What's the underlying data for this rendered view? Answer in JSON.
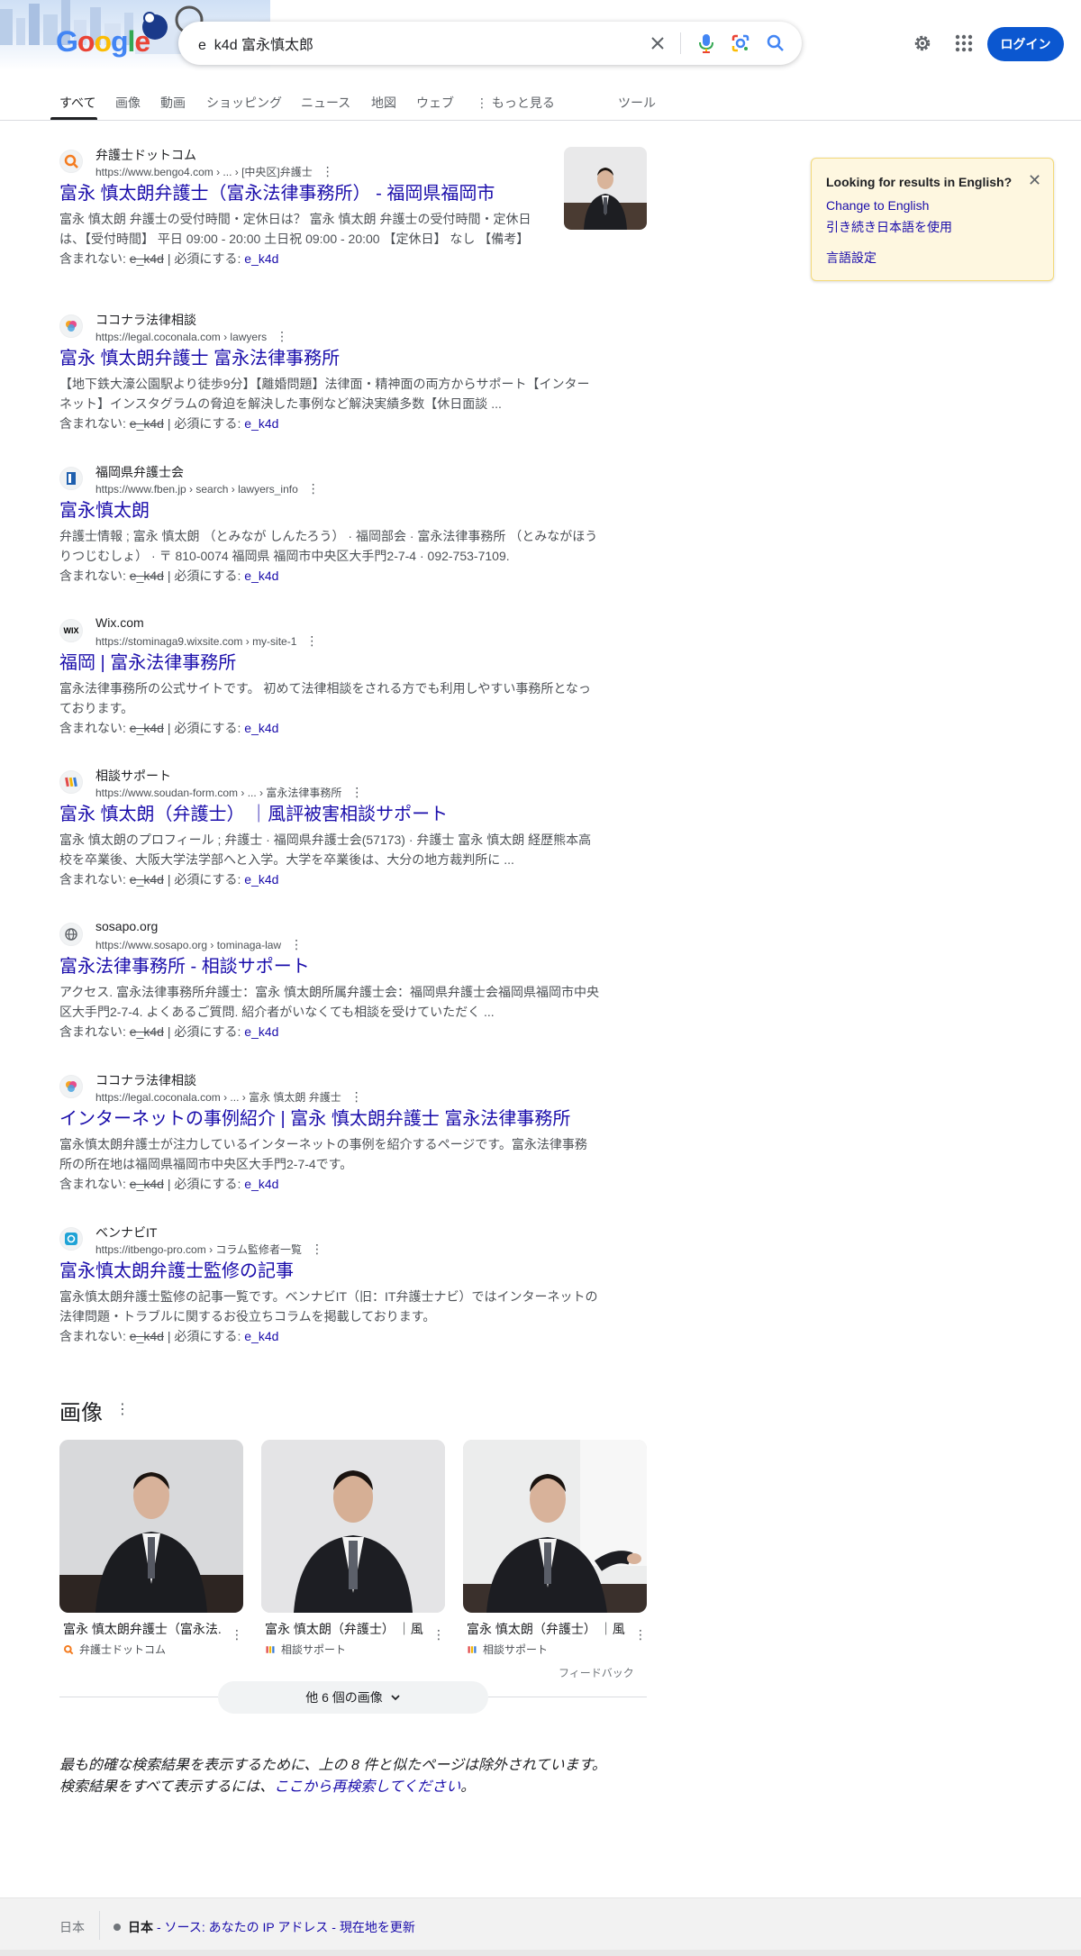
{
  "search": {
    "query": "e_k4d 富永慎太郎",
    "logo_text": "Google"
  },
  "header": {
    "login_label": "ログイン"
  },
  "tabs": [
    "すべて",
    "画像",
    "動画",
    "ショッピング",
    "ニュース",
    "地図",
    "ウェブ",
    "もっと見る",
    "ツール"
  ],
  "results": [
    {
      "site": "弁護士ドットコム",
      "url": "https://www.bengo4.com › ... › [中央区]弁護士",
      "title": "富永 慎太朗弁護士（富永法律事務所） - 福岡県福岡市",
      "snippet_line1": "富永 慎太朗 弁護士の受付時間・定休日は？ 富永 慎太朗 弁護士の受付時間・定休日",
      "snippet_line2": "は、【受付時間】 平日 09:00 - 20:00 土日祝 09:00 - 20:00 【定休日】 なし 【備考】",
      "favicon": "弁"
    },
    {
      "site": "ココナラ法律相談",
      "url": "https://legal.coconala.com › lawyers",
      "title": "富永 慎太朗弁護士 富永法律事務所",
      "snippet_line1": "【地下鉄大濠公園駅より徒歩9分】【離婚問題】法律面・精神面の両方からサポート【インター",
      "snippet_line2": "ネット】インスタグラムの脅迫を解決した事例など解決実績多数【休日面談 ...",
      "favicon": "coco"
    },
    {
      "site": "福岡県弁護士会",
      "url": "https://www.fben.jp › search › lawyers_info",
      "title": "富永慎太朗",
      "snippet_line1": "弁護士情報 ; 富永 慎太朗 （とみなが しんたろう） · 福岡部会 · 富永法律事務所 （とみながほう",
      "snippet_line2": "りつじむしょ） · 〒 810-0074 福岡県 福岡市中央区大手門2-7-4 · 092-753-7109.",
      "favicon": "福"
    },
    {
      "site": "Wix.com",
      "url": "https://stominaga9.wixsite.com › my-site-1",
      "title": "福岡 | 富永法律事務所",
      "snippet_line1": "富永法律事務所の公式サイトです。 初めて法律相談をされる方でも利用しやすい事務所となっ",
      "snippet_line2": "ております。",
      "favicon": "WIX"
    },
    {
      "site": "相談サポート",
      "url": "https://www.soudan-form.com › ... › 富永法律事務所",
      "title": "富永 慎太朗（弁護士） ｜風評被害相談サポート",
      "snippet_line1": "富永 慎太朗のプロフィール ; 弁護士 · 福岡県弁護士会(57173) · 弁護士 富永 慎太朗 経歴熊本高",
      "snippet_line2": "校を卒業後、大阪大学法学部へと入学。大学を卒業後は、大分の地方裁判所に ...",
      "favicon": "相"
    },
    {
      "site": "sosapo.org",
      "url": "https://www.sosapo.org › tominaga-law",
      "title": "富永法律事務所 - 相談サポート",
      "snippet_line1": "アクセス. 富永法律事務所弁護士：富永 慎太朗所属弁護士会：福岡県弁護士会福岡県福岡市中央",
      "snippet_line2": "区大手門2-7-4. よくあるご質問. 紹介者がいなくても相談を受けていただく ...",
      "favicon": "globe"
    },
    {
      "site": "ココナラ法律相談",
      "url": "https://legal.coconala.com › ... › 富永 慎太朗 弁護士",
      "title": "インターネットの事例紹介 | 富永 慎太朗弁護士 富永法律事務所",
      "snippet_line1": "富永慎太朗弁護士が注力しているインターネットの事例を紹介するページです。富永法律事務",
      "snippet_line2": "所の所在地は福岡県福岡市中央区大手門2-7-4です。",
      "favicon": "coco"
    },
    {
      "site": "ベンナビIT",
      "url": "https://itbengo-pro.com › コラム監修者一覧",
      "title": "富永慎太朗弁護士監修の記事",
      "snippet_line1": "富永慎太朗弁護士監修の記事一覧です。ベンナビIT（旧：IT弁護士ナビ）ではインターネットの",
      "snippet_line2": "法律問題・トラブルに関するお役立ちコラムを掲載しております。",
      "favicon": "ベ"
    }
  ],
  "missing": {
    "label": "含まれない:",
    "term": "e_k4d",
    "sep": "| 必須にする:",
    "required": "e_k4d"
  },
  "langcard": {
    "title": "Looking for results in English?",
    "link1": "Change to English",
    "link2": "引き続き日本語を使用",
    "link3": "言語設定"
  },
  "images": {
    "heading": "画像",
    "cards": [
      {
        "caption": "富永 慎太朗弁護士（富永法...",
        "source": "弁護士ドットコム"
      },
      {
        "caption": "富永 慎太朗（弁護士） ｜風...",
        "source": "相談サポート"
      },
      {
        "caption": "富永 慎太朗（弁護士） ｜風...",
        "source": "相談サポート"
      }
    ],
    "feedback": "フィードバック",
    "more": "他 6 個の画像"
  },
  "omitted": {
    "line1": "最も的確な検索結果を表示するために、上の 8 件と似たページは除外されています。",
    "line2_prefix": "検索結果をすべて表示するには、",
    "line2_link": "ここから再検索してください",
    "line2_suffix": "。"
  },
  "footer": {
    "country": "日本",
    "location": "日本",
    "source": "- ソース: あなたの IP アドレス -",
    "update": "現在地を更新"
  }
}
